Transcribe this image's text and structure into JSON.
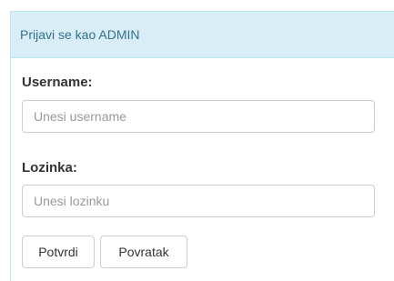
{
  "panel": {
    "heading": "Prijavi se kao ADMIN"
  },
  "form": {
    "username_label": "Username:",
    "username_placeholder": "Unesi username",
    "username_value": "",
    "password_label": "Lozinka:",
    "password_placeholder": "Unesi lozinku",
    "password_value": "",
    "confirm_button": "Potvrdi",
    "back_button": "Povratak"
  },
  "colors": {
    "heading_bg": "#d9edf7",
    "heading_border": "#bce8f1",
    "heading_text": "#31708f"
  }
}
